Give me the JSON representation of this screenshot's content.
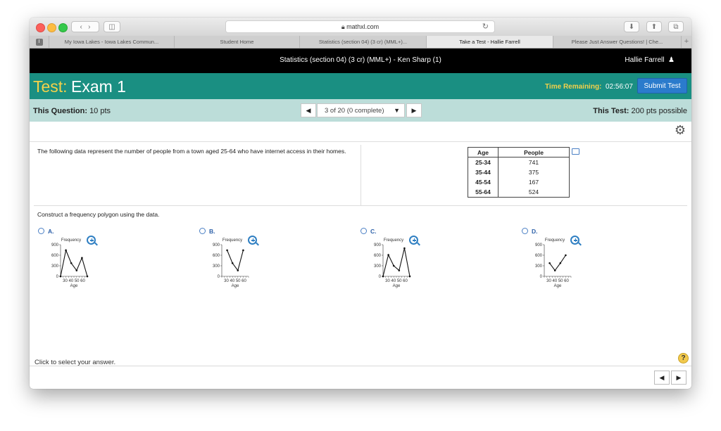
{
  "browser": {
    "url": "mathxl.com",
    "tabs": [
      {
        "label": "My Iowa Lakes - Iowa Lakes Commun...",
        "active": false
      },
      {
        "label": "Student Home",
        "active": false
      },
      {
        "label": "Statistics (section 04) (3 cr) (MML+)...",
        "active": false
      },
      {
        "label": "Take a Test - Hallie Farrell",
        "active": true
      },
      {
        "label": "Please Just Answer Questions! | Che...",
        "active": false
      }
    ],
    "tab_icon": "I",
    "plus": "+"
  },
  "header": {
    "course": "Statistics (section 04) (3 cr) (MML+) - Ken Sharp (1)",
    "user": "Hallie Farrell"
  },
  "exam": {
    "test_label": "Test:",
    "name": "Exam 1",
    "time_label": "Time Remaining:",
    "time_value": "02:56:07",
    "submit": "Submit Test"
  },
  "question_bar": {
    "question_label": "This Question:",
    "question_points": "10 pts",
    "navigator": "3 of 20 (0 complete)",
    "test_label": "This Test:",
    "test_points": "200 pts possible"
  },
  "problem": {
    "text": "The following data represent the number of people from a town aged 25-64 who have internet access in their homes.",
    "table": {
      "headers": [
        "Age",
        "People"
      ],
      "rows": [
        [
          "25-34",
          "741"
        ],
        [
          "35-44",
          "375"
        ],
        [
          "45-54",
          "167"
        ],
        [
          "55-64",
          "524"
        ]
      ]
    },
    "instruction": "Construct a frequency polygon using the data."
  },
  "options": [
    {
      "label": "A.",
      "title": "Frequency",
      "xlabel": "Age",
      "yticks": [
        "900",
        "600",
        "300",
        "0"
      ],
      "xticks": "30 40 50 60",
      "points": [
        [
          20,
          0
        ],
        [
          30,
          741
        ],
        [
          40,
          375
        ],
        [
          50,
          167
        ],
        [
          60,
          524
        ],
        [
          70,
          0
        ]
      ]
    },
    {
      "label": "B.",
      "title": "Frequency",
      "xlabel": "Age",
      "yticks": [
        "900",
        "600",
        "300",
        "0"
      ],
      "xticks": "30 40 50 60",
      "points": [
        [
          30,
          741
        ],
        [
          40,
          375
        ],
        [
          50,
          167
        ],
        [
          60,
          741
        ]
      ]
    },
    {
      "label": "C.",
      "title": "Frequency",
      "xlabel": "Age",
      "yticks": [
        "900",
        "600",
        "300",
        "0"
      ],
      "xticks": "30 40 50 60",
      "points": [
        [
          20,
          0
        ],
        [
          30,
          610
        ],
        [
          40,
          300
        ],
        [
          50,
          167
        ],
        [
          60,
          800
        ],
        [
          70,
          0
        ]
      ]
    },
    {
      "label": "D.",
      "title": "Frequency",
      "xlabel": "Age",
      "yticks": [
        "900",
        "600",
        "300",
        "0"
      ],
      "xticks": "30 40 50 60",
      "points": [
        [
          30,
          375
        ],
        [
          40,
          167
        ],
        [
          50,
          375
        ],
        [
          60,
          600
        ]
      ]
    }
  ],
  "footer": {
    "hint": "Click to select your answer.",
    "help": "?"
  }
}
